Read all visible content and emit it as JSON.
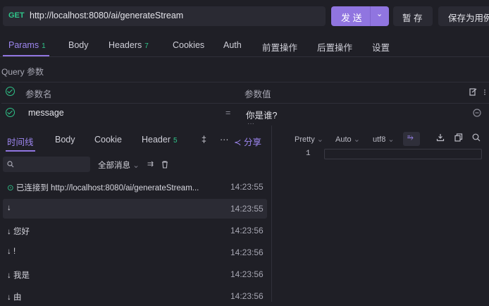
{
  "request": {
    "method": "GET",
    "url": "http://localhost:8080/ai/generateStream",
    "send_label": "发 送",
    "save_label": "暂 存",
    "save_as_label": "保存为用例"
  },
  "request_tabs": [
    {
      "label": "Params",
      "badge": "1"
    },
    {
      "label": "Body",
      "badge": ""
    },
    {
      "label": "Headers",
      "badge": "7"
    },
    {
      "label": "Cookies",
      "badge": ""
    },
    {
      "label": "Auth",
      "badge": ""
    },
    {
      "label": "前置操作",
      "badge": ""
    },
    {
      "label": "后置操作",
      "badge": ""
    },
    {
      "label": "设置",
      "badge": ""
    }
  ],
  "params": {
    "section_label": "Query 参数",
    "col_name": "参数名",
    "col_value": "参数值",
    "rows": [
      {
        "name": "message",
        "eq": "=",
        "value": "你是谁?"
      }
    ]
  },
  "response_tabs": {
    "timeline": "时间线",
    "body": "Body",
    "cookie": "Cookie",
    "header": "Header",
    "header_badge": "5",
    "extra": "‡",
    "more": "···",
    "share": "分享"
  },
  "filter": {
    "all_messages": "全部消息"
  },
  "messages": [
    {
      "icon": "check",
      "text": "已连接到 http://localhost:8080/ai/generateStream...",
      "time": "14:23:55"
    },
    {
      "icon": "arrow",
      "text": "",
      "time": "14:23:55"
    },
    {
      "icon": "arrow",
      "text": "您好",
      "time": "14:23:56"
    },
    {
      "icon": "arrow",
      "text": "!",
      "time": "14:23:56"
    },
    {
      "icon": "arrow",
      "text": "我是",
      "time": "14:23:56"
    },
    {
      "icon": "arrow",
      "text": "由",
      "time": "14:23:56"
    }
  ],
  "viewer": {
    "format": "Pretty",
    "mode": "Auto",
    "encoding": "utf8",
    "line_number": "1"
  },
  "colors": {
    "accent": "#9075e0",
    "success": "#2fc58a",
    "background": "#1f1f26"
  }
}
